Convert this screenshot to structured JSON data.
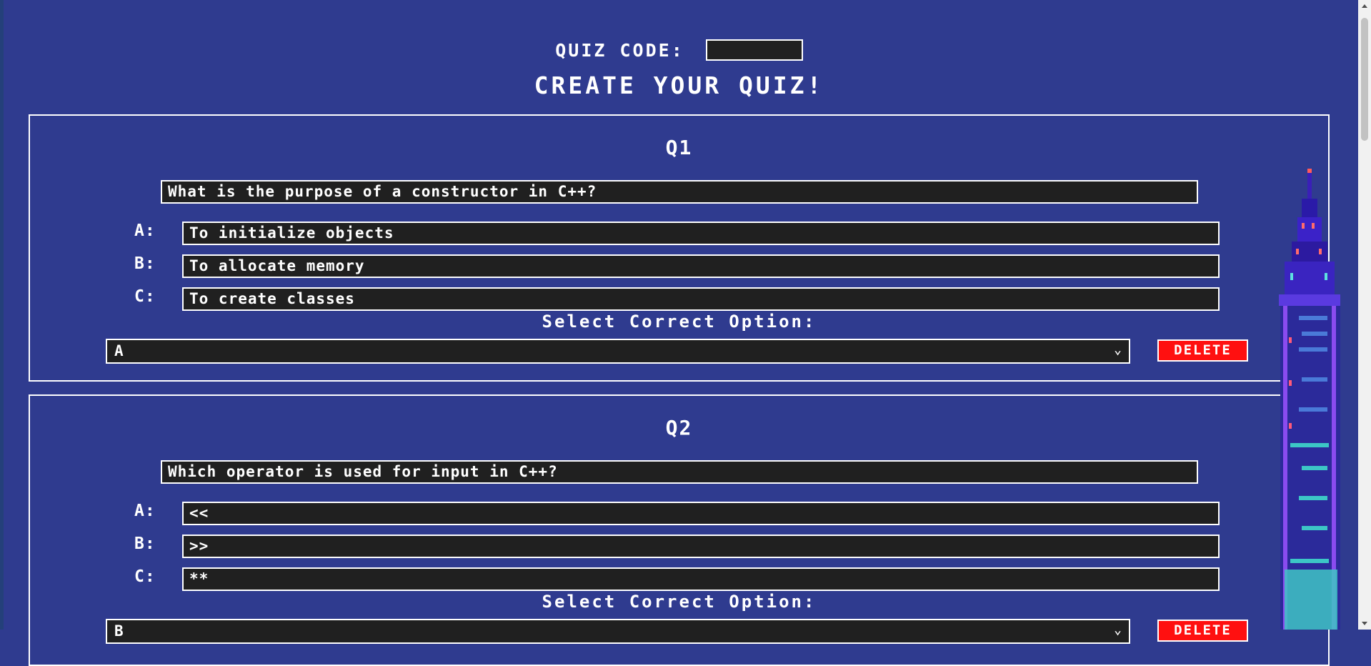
{
  "header": {
    "quiz_code_label": "QUIZ CODE:",
    "quiz_code_value": "",
    "title": "CREATE YOUR QUIZ!"
  },
  "select_label": "Select Correct Option:",
  "delete_label": "DELETE",
  "questions": [
    {
      "number": "Q1",
      "text": "What is the purpose of a constructor in C++?",
      "options": [
        {
          "label": "A:",
          "value": "To initialize objects"
        },
        {
          "label": "B:",
          "value": "To allocate memory"
        },
        {
          "label": "C:",
          "value": "To create classes"
        }
      ],
      "correct": "A"
    },
    {
      "number": "Q2",
      "text": "Which operator is used for input in C++?",
      "options": [
        {
          "label": "A:",
          "value": "<<"
        },
        {
          "label": "B:",
          "value": ">>"
        },
        {
          "label": "C:",
          "value": "**"
        }
      ],
      "correct": "B"
    }
  ],
  "colors": {
    "background": "#2f3b8f",
    "field": "#202020",
    "delete": "#ff1010",
    "border": "#ffffff"
  }
}
